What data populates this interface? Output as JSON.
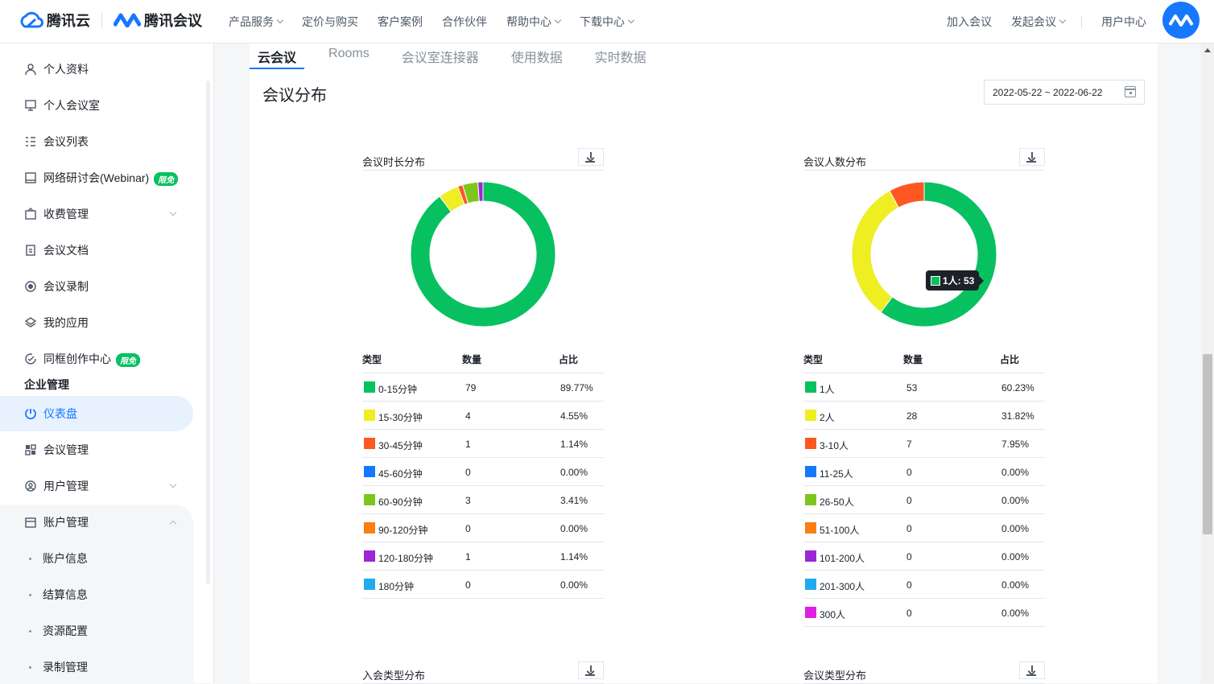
{
  "header": {
    "brand": "腾讯云",
    "product": "腾讯会议",
    "nav": [
      "产品服务",
      "定价与购买",
      "客户案例",
      "合作伙伴",
      "帮助中心",
      "下载中心"
    ],
    "nav_has_caret": [
      true,
      false,
      false,
      false,
      true,
      true
    ],
    "right_nav": [
      "加入会议",
      "发起会议",
      "用户中心"
    ],
    "brand_color": "#1677ff"
  },
  "sidebar": {
    "items": [
      {
        "label": "个人资料",
        "icon": "user-icon"
      },
      {
        "label": "个人会议室",
        "icon": "meeting-room-icon"
      },
      {
        "label": "会议列表",
        "icon": "list-icon"
      },
      {
        "label": "网络研讨会(Webinar)",
        "icon": "webinar-icon",
        "badge": "限免"
      },
      {
        "label": "收费管理",
        "icon": "wallet-icon"
      },
      {
        "label": "会议文档",
        "icon": "document-icon"
      },
      {
        "label": "会议录制",
        "icon": "record-icon"
      },
      {
        "label": "我的应用",
        "icon": "layers-icon"
      },
      {
        "label": "同框创作中心",
        "icon": "creation-icon",
        "badge": "限免"
      }
    ],
    "section": "企业管理",
    "admin_items": [
      {
        "label": "仪表盘",
        "icon": "dashboard-icon",
        "active": true
      },
      {
        "label": "会议管理",
        "icon": "grid-icon"
      },
      {
        "label": "用户管理",
        "icon": "users-icon"
      },
      {
        "label": "账户管理",
        "icon": "account-icon"
      }
    ],
    "sub_items": [
      "账户信息",
      "结算信息",
      "资源配置",
      "录制管理"
    ]
  },
  "tabs": [
    "云会议",
    "Rooms",
    "会议室连接器",
    "使用数据",
    "实时数据"
  ],
  "active_tab": "云会议",
  "section_title": "会议分布",
  "date_range": "2022-05-22 ~ 2022-06-22",
  "table_headers": {
    "type": "类型",
    "count": "数量",
    "share": "占比"
  },
  "chart_data": [
    {
      "type": "pie",
      "title": "会议时长分布",
      "categories": [
        "0-15分钟",
        "15-30分钟",
        "30-45分钟",
        "45-60分钟",
        "60-90分钟",
        "90-120分钟",
        "120-180分钟",
        "180分钟"
      ],
      "values": [
        79,
        4,
        1,
        0,
        3,
        0,
        1,
        0
      ],
      "percent": [
        "89.77%",
        "4.55%",
        "1.14%",
        "0.00%",
        "3.41%",
        "0.00%",
        "1.14%",
        "0.00%"
      ],
      "colors": [
        "#07c160",
        "#eeee22",
        "#ff5722",
        "#1677ff",
        "#7cc61e",
        "#fd7e14",
        "#9c27d6",
        "#22aaee"
      ]
    },
    {
      "type": "pie",
      "title": "会议人数分布",
      "categories": [
        "1人",
        "2人",
        "3-10人",
        "11-25人",
        "26-50人",
        "51-100人",
        "101-200人",
        "201-300人",
        "300人"
      ],
      "values": [
        53,
        28,
        7,
        0,
        0,
        0,
        0,
        0,
        0
      ],
      "percent": [
        "60.23%",
        "31.82%",
        "7.95%",
        "0.00%",
        "0.00%",
        "0.00%",
        "0.00%",
        "0.00%",
        "0.00%"
      ],
      "colors": [
        "#07c160",
        "#eeee22",
        "#ff5722",
        "#1677ff",
        "#7cc61e",
        "#fd7e14",
        "#9c27d6",
        "#22aaee",
        "#e020e0"
      ],
      "tooltip": "1人: 53"
    }
  ],
  "lower_panels": [
    "入会类型分布",
    "会议类型分布"
  ]
}
